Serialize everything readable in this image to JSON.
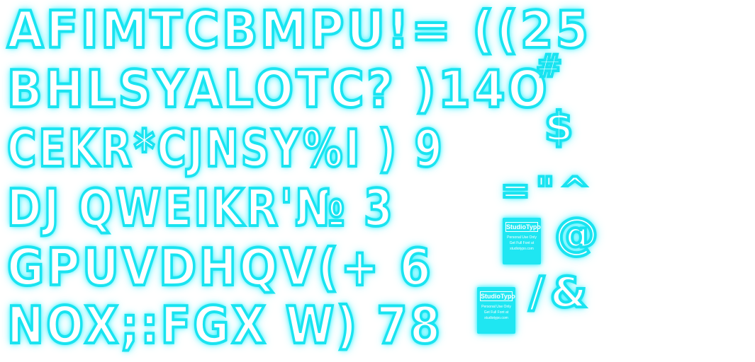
{
  "specimen": {
    "rows": [
      "AFIMTCBMPU!= ((25",
      "BHLSYALOTC?  )14O",
      "CEKR*CJNSY%I  ) 9",
      "DJ QWEIKR'№  3",
      "GPUVDHQV(+  6",
      "NOX;:FGX W)  78"
    ],
    "extras": {
      "hash": "#",
      "dollar": "$",
      "quotes": "=\"^",
      "at": "@",
      "slash_amp": "/&"
    },
    "badges": [
      {
        "title": "StudioTypo",
        "line1": "Personal Use Only",
        "line2": "Get Full Font at",
        "line3": "studiotypo.com"
      },
      {
        "title": "StudioTypo",
        "line1": "Personal Use Only",
        "line2": "Get Full Font at",
        "line3": "studiotypo.com"
      }
    ],
    "colors": {
      "glyph_outline": "#19e3f0",
      "glow": "#28f0ff",
      "background": "#ffffff"
    }
  }
}
